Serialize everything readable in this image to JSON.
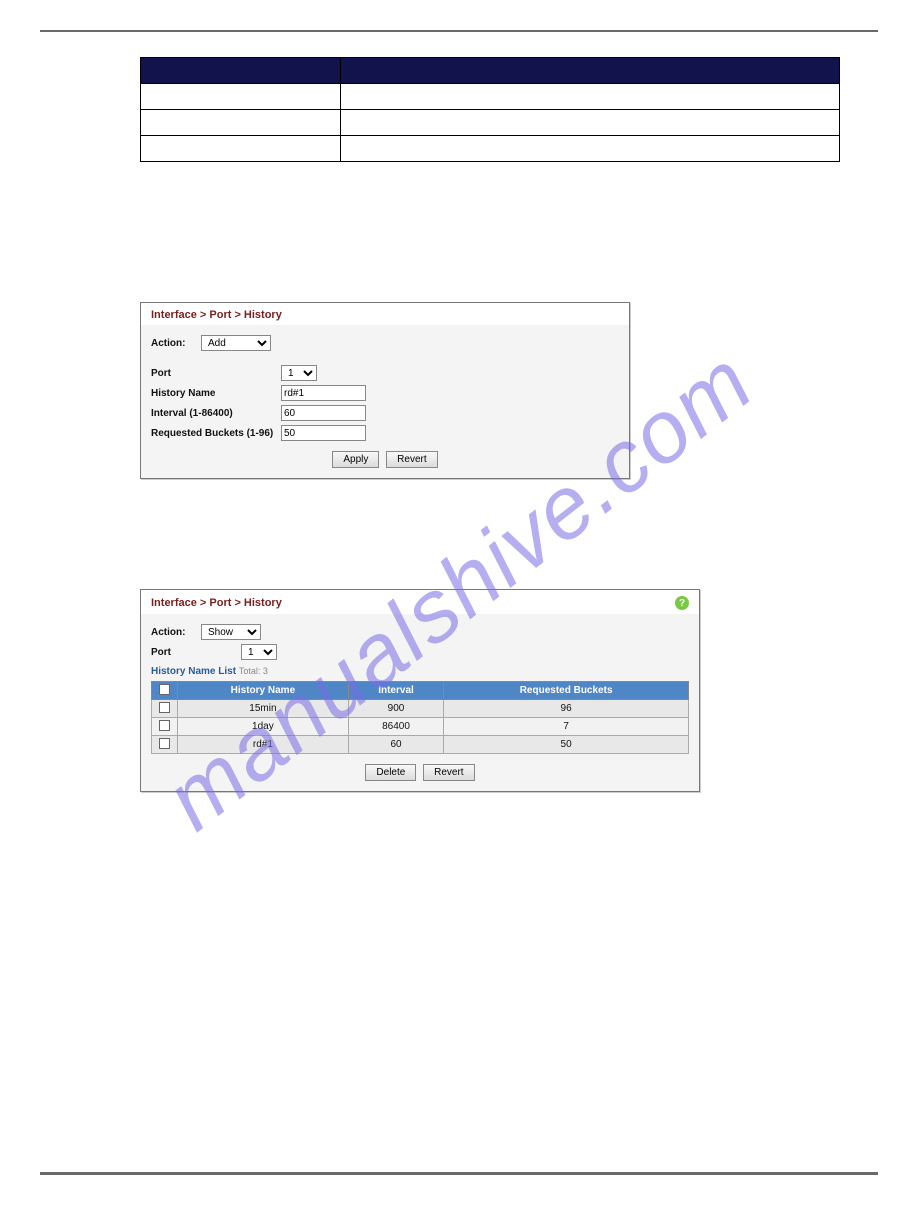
{
  "watermark": "manualshive.com",
  "param_table": {
    "rows": [
      {
        "param": "",
        "desc": ""
      },
      {
        "param": "",
        "desc": ""
      },
      {
        "param": "",
        "desc": ""
      }
    ]
  },
  "panel_add": {
    "breadcrumb": "Interface > Port > History",
    "action_label": "Action:",
    "action_value": "Add",
    "port_label": "Port",
    "port_value": "1",
    "history_name_label": "History Name",
    "history_name_value": "rd#1",
    "interval_label": "Interval (1-86400)",
    "interval_value": "60",
    "buckets_label": "Requested Buckets (1-96)",
    "buckets_value": "50",
    "apply_btn": "Apply",
    "revert_btn": "Revert"
  },
  "panel_show": {
    "breadcrumb": "Interface > Port > History",
    "action_label": "Action:",
    "action_value": "Show",
    "port_label": "Port",
    "port_value": "1",
    "list_title": "History Name List",
    "total_label": "Total: 3",
    "headers": {
      "name": "History Name",
      "interval": "Interval",
      "buckets": "Requested Buckets"
    },
    "rows": [
      {
        "name": "15min",
        "interval": "900",
        "buckets": "96"
      },
      {
        "name": "1day",
        "interval": "86400",
        "buckets": "7"
      },
      {
        "name": "rd#1",
        "interval": "60",
        "buckets": "50"
      }
    ],
    "delete_btn": "Delete",
    "revert_btn": "Revert"
  },
  "chart_data": [
    {
      "type": "table",
      "title": "History Name List",
      "columns": [
        "History Name",
        "Interval",
        "Requested Buckets"
      ],
      "rows": [
        [
          "15min",
          900,
          96
        ],
        [
          "1day",
          86400,
          7
        ],
        [
          "rd#1",
          60,
          50
        ]
      ]
    }
  ]
}
